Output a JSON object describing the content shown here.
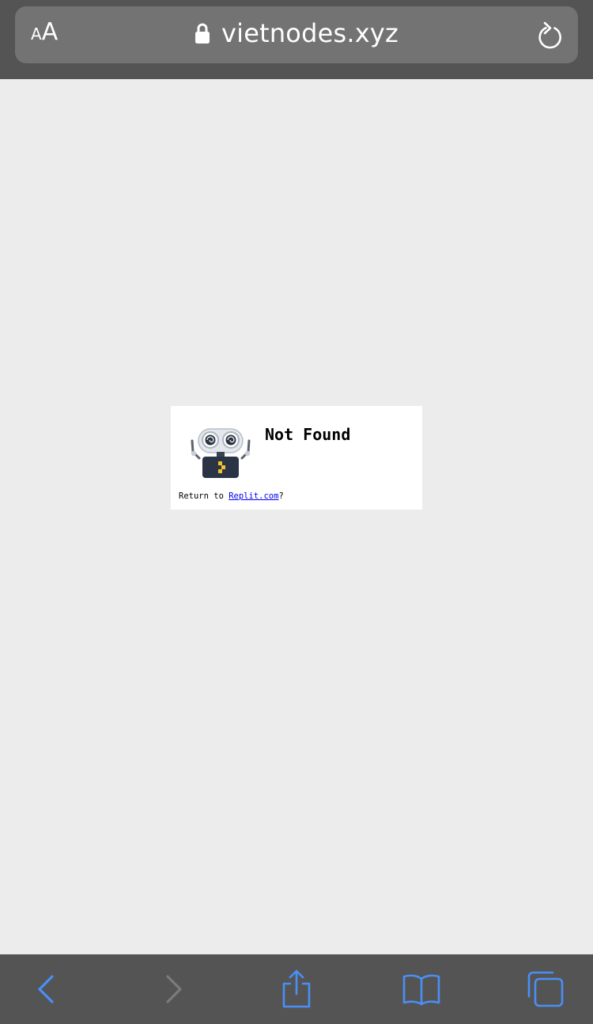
{
  "browser": {
    "text_size_small": "A",
    "text_size_big": "A",
    "url": "vietnodes.xyz",
    "accent_color": "#4a8ff7",
    "disabled_color": "#7b7b7b"
  },
  "page": {
    "title": "Not Found",
    "return_prefix": "Return to ",
    "return_link": "Replit.com",
    "return_suffix": "?"
  },
  "toolbar": {
    "items": [
      {
        "icon": "back-icon",
        "enabled": true
      },
      {
        "icon": "forward-icon",
        "enabled": false
      },
      {
        "icon": "share-icon",
        "enabled": true
      },
      {
        "icon": "bookmarks-icon",
        "enabled": true
      },
      {
        "icon": "tabs-icon",
        "enabled": true
      }
    ]
  }
}
